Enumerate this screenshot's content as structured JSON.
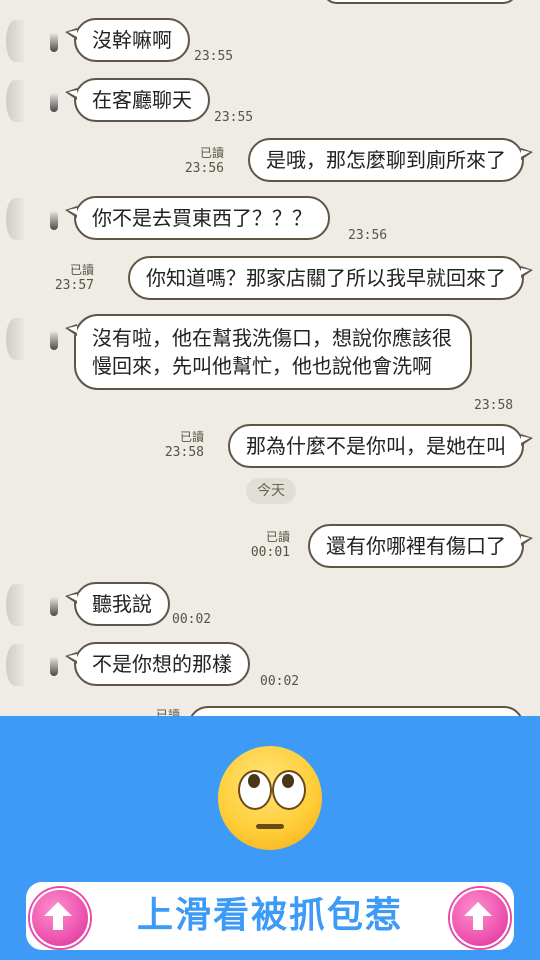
{
  "chat": {
    "messages": [
      {
        "text": "沒幹嘛啊",
        "time": "23:55"
      },
      {
        "text": "在客廳聊天",
        "time": "23:55"
      },
      {
        "text": "是哦，那怎麼聊到廁所來了",
        "read": "已讀",
        "time": "23:56"
      },
      {
        "text": "你不是去買東西了？？？",
        "time": "23:56"
      },
      {
        "text": "你知道嗎？那家店關了所以我早就回來了",
        "read": "已讀",
        "time": "23:57"
      },
      {
        "text": "沒有啦，他在幫我洗傷口，想說你應該很慢回來，先叫他幫忙，他也說他會洗啊",
        "time": "23:58"
      },
      {
        "text": "那為什麼不是你叫，是她在叫",
        "read": "已讀",
        "time": "23:58"
      },
      {
        "text": "還有你哪裡有傷口了",
        "read": "已讀",
        "time": "00:01"
      },
      {
        "text": "聽我說",
        "time": "00:02"
      },
      {
        "text": "不是你想的那樣",
        "time": "00:02"
      }
    ],
    "date_divider": "今天",
    "partial_read": "已讀"
  },
  "promo": {
    "emoji": "face-with-rolling-eyes",
    "swipe_label": "上滑看被抓包惹",
    "background": "#3d9af7",
    "accent": "#e94aa8"
  }
}
